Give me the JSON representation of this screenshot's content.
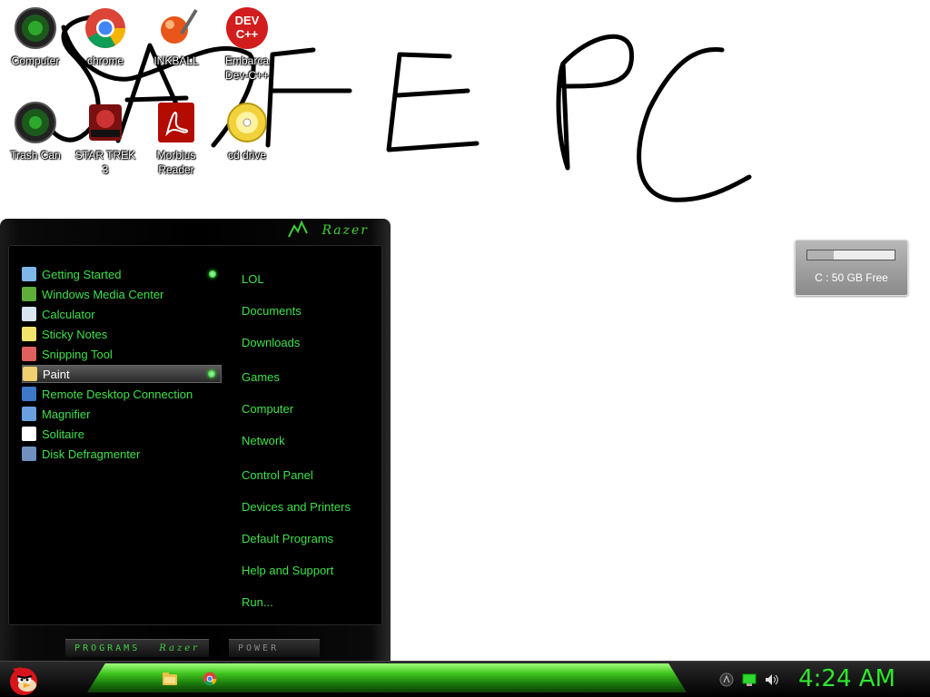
{
  "desktop": {
    "icons": [
      {
        "label": "Computer"
      },
      {
        "label": "chrome"
      },
      {
        "label": "INKBALL"
      },
      {
        "label": "Embarca\nDev-C++"
      },
      {
        "label": "Trash Can"
      },
      {
        "label": "STAR TREK 3"
      },
      {
        "label": "Morbius Reader"
      },
      {
        "label": "cd drive"
      }
    ],
    "dev_icon_text": "DEV C++"
  },
  "drive_gadget": {
    "label": "C : 50 GB Free",
    "used_fraction": 0.3
  },
  "start_menu": {
    "brand": "Razer",
    "programs": [
      {
        "label": "Getting Started",
        "icon": "getting-started-icon",
        "has_submenu": true
      },
      {
        "label": "Windows Media Center",
        "icon": "media-center-icon"
      },
      {
        "label": "Calculator",
        "icon": "calculator-icon"
      },
      {
        "label": "Sticky Notes",
        "icon": "sticky-notes-icon"
      },
      {
        "label": "Snipping Tool",
        "icon": "snipping-tool-icon"
      },
      {
        "label": "Paint",
        "icon": "paint-icon",
        "has_submenu": true,
        "selected": true
      },
      {
        "label": "Remote Desktop Connection",
        "icon": "remote-desktop-icon"
      },
      {
        "label": "Magnifier",
        "icon": "magnifier-icon"
      },
      {
        "label": "Solitaire",
        "icon": "solitaire-icon"
      },
      {
        "label": "Disk Defragmenter",
        "icon": "defrag-icon"
      }
    ],
    "places": [
      {
        "label": "LOL"
      },
      {
        "label": "Documents"
      },
      {
        "label": "Downloads"
      },
      {
        "label": "Games"
      },
      {
        "label": "Computer"
      },
      {
        "label": "Network"
      },
      {
        "label": "Control Panel"
      },
      {
        "label": "Devices and Printers"
      },
      {
        "label": "Default Programs"
      },
      {
        "label": "Help and Support"
      },
      {
        "label": "Run..."
      }
    ],
    "programs_button": "PROGRAMS",
    "programs_button_brand": "Razer",
    "power_button": "POWER"
  },
  "taskbar": {
    "clock": "4:24 AM",
    "pinned": [
      "explorer-icon",
      "chrome-icon"
    ],
    "tray": [
      "razer-tray-icon",
      "network-icon",
      "volume-icon"
    ]
  },
  "colors": {
    "accent_green": "#3ee04a",
    "clock_green": "#2ee62e"
  }
}
